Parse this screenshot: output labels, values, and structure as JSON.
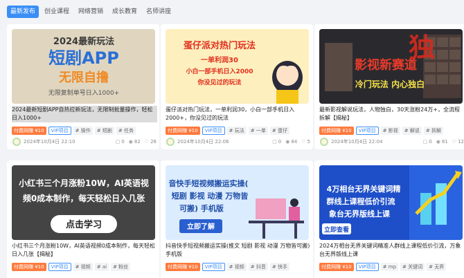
{
  "tabs": [
    "最新发布",
    "创业课程",
    "网络营销",
    "成长教育",
    "名师讲座"
  ],
  "cards": [
    {
      "title": "2024最新短剧APP自热拉新玩法，无限制批量操作，轻松日入1000+",
      "price": "付费网赚 ¥10",
      "vip": "VIP项目",
      "tags": [
        "# 操作",
        "# 短剧",
        "# 任务"
      ],
      "date": "2024年10月4日 22:10",
      "comments": "0",
      "views": "82",
      "likes": "26",
      "thumb": {
        "l1": "2024最新玩法",
        "l2": "短剧APP",
        "l3": "无限自撸",
        "l4": "无限复制单号日入1000+"
      }
    },
    {
      "title": "蛋仔派对热门玩法，一单利润30，小白一部手机日入2000+，你没见过的玩法",
      "price": "付费网赚 ¥10",
      "vip": "VIP项目",
      "tags": [
        "# 玩法",
        "# 一单",
        "# 蛋仔"
      ],
      "date": "2024年10月4日 22:06",
      "comments": "0",
      "views": "84",
      "likes": "5",
      "thumb": {
        "l1": "蛋仔派对热门玩法",
        "l2": "一单利润30",
        "l3": "小白一部手机日入2000",
        "l4": "你没见过的玩法"
      }
    },
    {
      "title": "最新影视解说玩法，人物独白，30天涨粉24万+，全流程拆解【揭秘】",
      "price": "付费网赚 ¥10",
      "vip": "VIP项目",
      "tags": [
        "# 影视",
        "# 解说",
        "# 拆解"
      ],
      "date": "2024年10月4日 22:04",
      "comments": "0",
      "views": "81",
      "likes": "12",
      "thumb": {
        "l1": "影视新赛道",
        "l2": "冷门玩法  内心独白",
        "l3": "独"
      }
    },
    {
      "title": "小红书三个月涨粉10W，AI英语视频0成本制作，每天轻松日入几张【揭秘】",
      "price": "付费网赚 ¥10",
      "vip": "VIP项目",
      "tags": [
        "# 视频",
        "# ai",
        "# 粉丝"
      ],
      "thumb": {
        "l1": "小红书三个月涨粉10W，AI英语视",
        "l2": "频0成本制作，每天轻松日入几张",
        "l3": "点击学习"
      }
    },
    {
      "title": "抖音快手短视频搬运实操(推文 短剧 影视 动漫 万物皆可搬) 手机版",
      "price": "付费网赚 ¥10",
      "vip": "VIP项目",
      "tags": [
        "# 视频",
        "# 抖音",
        "# 快手"
      ],
      "thumb": {
        "l1": "音快手短视频搬运实操(",
        "l2": "短剧 影视 动漫 万物皆",
        "l3": "可搬) 手机版",
        "l4": "立即了解"
      }
    },
    {
      "title": "2024万相台无界关键词精准人群线上课程低价引流，万象台无界版线上课",
      "price": "付费网赚 ¥10",
      "vip": "VIP项目",
      "tags": [
        "# mp",
        "# 关键词",
        "# 无界"
      ],
      "thumb": {
        "l1": "4万相台无界关键词精",
        "l2": "群线上课程低价引流",
        "l3": "象台无界版线上课",
        "l4": "立即查看"
      }
    }
  ]
}
